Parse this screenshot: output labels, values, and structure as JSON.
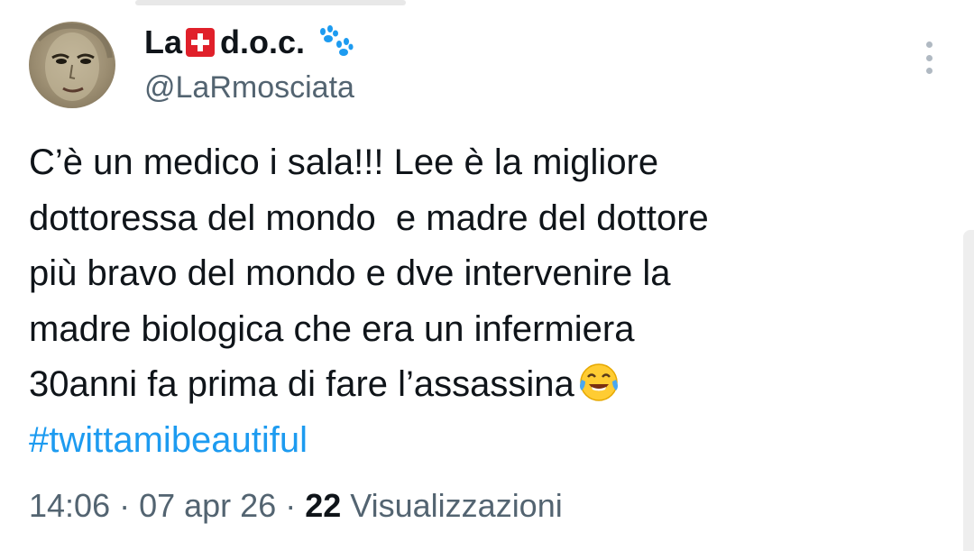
{
  "author": {
    "name_part1": "La",
    "name_part2": "d.o.c.",
    "flag_icon": "swiss-flag-icon",
    "badge_icon": "paw-prints-icon",
    "handle": "@LaRmosciata"
  },
  "tweet": {
    "lines": [
      "C’è un medico i sala!!! Lee è la migliore",
      "dottoressa del mondo  e madre del dottore",
      "più bravo del mondo e dve intervenire la",
      "madre biologica che era un infermiera",
      "30anni fa prima di fare l’assassina"
    ],
    "emoji": "face-with-tears-of-joy-icon",
    "hashtag": "#twittamibeautiful"
  },
  "meta": {
    "time": "14:06",
    "sep1": " · ",
    "date": "07 apr 26",
    "sep2": " · ",
    "views_count": "22",
    "views_label": " Visualizzazioni"
  },
  "colors": {
    "text": "#0f1419",
    "secondary": "#536471",
    "link": "#1d9bf0",
    "flag": "#e0202a",
    "paw": "#1d9bf0"
  }
}
